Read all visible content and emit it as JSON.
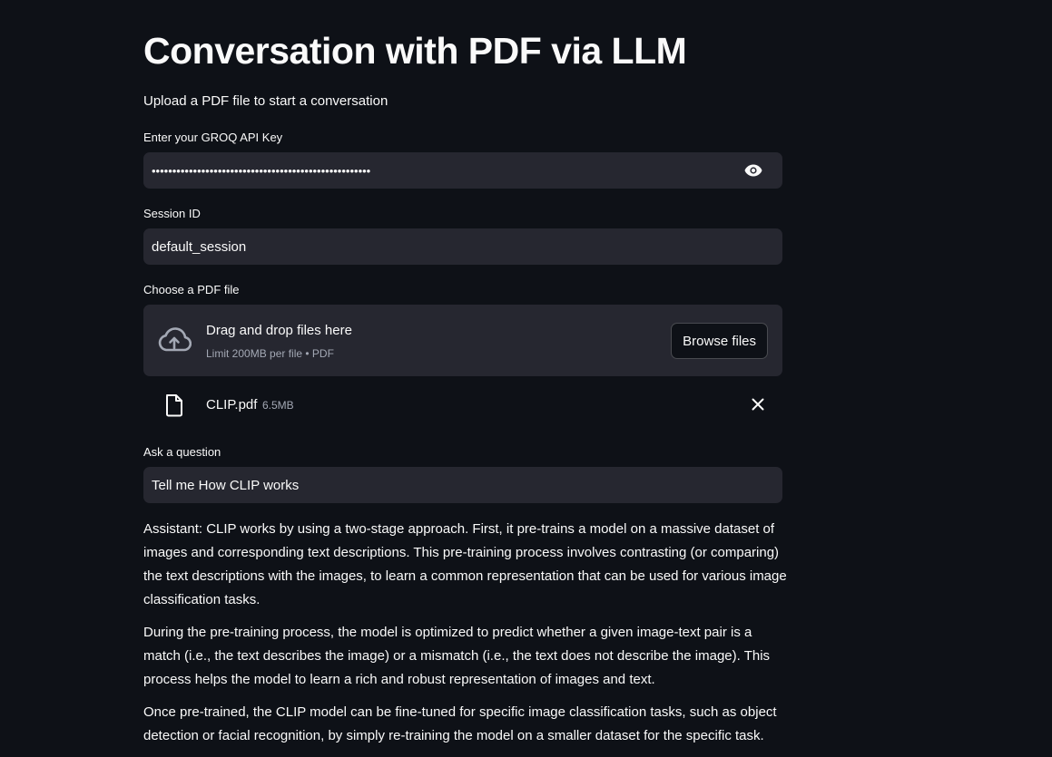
{
  "page": {
    "title": "Conversation with PDF via LLM",
    "subtitle": "Upload a PDF file to start a conversation"
  },
  "api_key": {
    "label": "Enter your GROQ API Key",
    "masked_value": "•••••••••••••••••••••••••••••••••••••••••••••••••••••",
    "toggle_icon": "eye-icon"
  },
  "session": {
    "label": "Session ID",
    "value": "default_session"
  },
  "uploader": {
    "label": "Choose a PDF file",
    "drop_text": "Drag and drop files here",
    "limit_text": "Limit 200MB per file • PDF",
    "browse_label": "Browse files",
    "icon": "cloud-upload-icon"
  },
  "uploaded_file": {
    "name": "CLIP.pdf",
    "size": "6.5MB",
    "icon": "file-icon",
    "remove_icon": "close-icon"
  },
  "question": {
    "label": "Ask a question",
    "value": "Tell me How CLIP works"
  },
  "answer": {
    "paragraphs": [
      "Assistant: CLIP works by using a two-stage approach. First, it pre-trains a model on a massive dataset of images and corresponding text descriptions. This pre-training process involves contrasting (or comparing) the text descriptions with the images, to learn a common representation that can be used for various image classification tasks.",
      "During the pre-training process, the model is optimized to predict whether a given image-text pair is a match (i.e., the text describes the image) or a mismatch (i.e., the text does not describe the image). This process helps the model to learn a rich and robust representation of images and text.",
      "Once pre-trained, the CLIP model can be fine-tuned for specific image classification tasks, such as object detection or facial recognition, by simply re-training the model on a smaller dataset for the specific task."
    ]
  }
}
